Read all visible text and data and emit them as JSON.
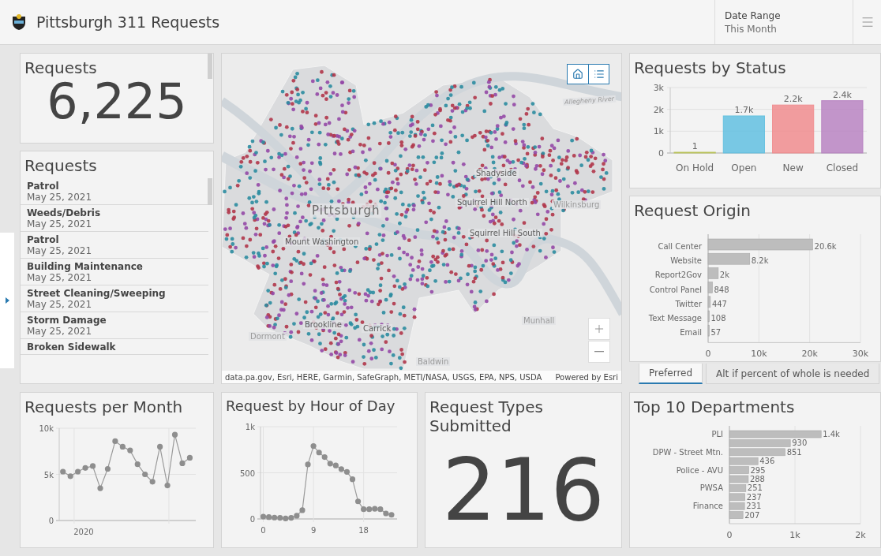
{
  "header": {
    "title": "Pittsburgh 311 Requests",
    "date_range": {
      "label": "Date Range",
      "value": "This Month"
    }
  },
  "request_count": {
    "title": "Requests",
    "value": "6,225"
  },
  "request_list": {
    "title": "Requests",
    "items": [
      {
        "type": "Patrol",
        "date": "May 25, 2021"
      },
      {
        "type": "Weeds/Debris",
        "date": "May 25, 2021"
      },
      {
        "type": "Patrol",
        "date": "May 25, 2021"
      },
      {
        "type": "Building Maintenance",
        "date": "May 25, 2021"
      },
      {
        "type": "Street Cleaning/Sweeping",
        "date": "May 25, 2021"
      },
      {
        "type": "Storm Damage",
        "date": "May 25, 2021"
      },
      {
        "type": "Broken Sidewalk"
      }
    ]
  },
  "map": {
    "place_labels": [
      {
        "text": "Pittsburgh",
        "kind": "city"
      },
      {
        "text": "Mount Washington",
        "kind": "neighborhood"
      },
      {
        "text": "Shadyside",
        "kind": "neighborhood"
      },
      {
        "text": "Squirrel Hill North",
        "kind": "neighborhood"
      },
      {
        "text": "Squirrel Hill South",
        "kind": "neighborhood"
      },
      {
        "text": "Wilkinsburg",
        "kind": "town"
      },
      {
        "text": "Brookline",
        "kind": "neighborhood"
      },
      {
        "text": "Carrick",
        "kind": "neighborhood"
      },
      {
        "text": "Dormont",
        "kind": "town"
      },
      {
        "text": "Munhall",
        "kind": "town"
      },
      {
        "text": "Baldwin",
        "kind": "town"
      },
      {
        "text": "Allegheny River",
        "kind": "river"
      }
    ],
    "attribution": "data.pa.gov, Esri, HERE, Garmin, SafeGraph, METI/NASA, USGS, EPA, NPS, USDA",
    "powered_by": "Powered by Esri"
  },
  "status_panel": {
    "title": "Requests by Status",
    "chart_data": {
      "type": "bar",
      "categories": [
        "On Hold",
        "Open",
        "New",
        "Closed"
      ],
      "series": [
        {
          "values": [
            1,
            1700,
            2200,
            2400
          ]
        }
      ],
      "colors": [
        "#b9c25a",
        "#62c0e0",
        "#f08c8e",
        "#b884c2"
      ],
      "ylim": [
        0,
        3000
      ],
      "yticks": [
        {
          "value": 0,
          "label": "0"
        },
        {
          "value": 1000,
          "label": "1k"
        },
        {
          "value": 2000,
          "label": "2k"
        },
        {
          "value": 3000,
          "label": "3k"
        }
      ],
      "value_labels": [
        "1",
        "1.7k",
        "2.2k",
        "2.4k"
      ]
    }
  },
  "origin_panel": {
    "title": "Request Origin",
    "chart_data": {
      "type": "bar",
      "orientation": "horizontal",
      "categories": [
        "Call Center",
        "Website",
        "Report2Gov",
        "Control Panel",
        "Twitter",
        "Text Message",
        "Email"
      ],
      "series": [
        {
          "color": "#bdbdbd",
          "values": [
            20600,
            8200,
            2000,
            848,
            447,
            108,
            57
          ]
        }
      ],
      "xlim": [
        0,
        30000
      ],
      "xticks": [
        {
          "value": 0,
          "label": "0"
        },
        {
          "value": 10000,
          "label": "10k"
        },
        {
          "value": 20000,
          "label": "20k"
        },
        {
          "value": 30000,
          "label": "30k"
        }
      ],
      "value_labels": [
        "20.6k",
        "8.2k",
        "2k",
        "848",
        "447",
        "108",
        "57"
      ]
    },
    "tabs": [
      {
        "label": "Preferred",
        "selected": true
      },
      {
        "label": "Alt if percent of whole is needed",
        "selected": false
      }
    ]
  },
  "monthly_panel": {
    "title": "Requests per Month",
    "chart_data": {
      "type": "line",
      "grid": true,
      "series": [
        {
          "color": "#9a9a9a",
          "marker": "circle",
          "values": [
            5300,
            4800,
            5300,
            5700,
            5900,
            3500,
            5600,
            8600,
            8000,
            7600,
            6100,
            5000,
            4200,
            8000,
            3800,
            9300,
            6200,
            6800
          ]
        }
      ],
      "ylim": [
        0,
        10000
      ],
      "yticks": [
        {
          "value": 0,
          "label": "0"
        },
        {
          "value": 5000,
          "label": "5k"
        },
        {
          "value": 10000,
          "label": "10k"
        }
      ],
      "annotations": [
        {
          "text": "2020"
        }
      ]
    }
  },
  "hourly_panel": {
    "title": "Request by Hour of Day",
    "chart_data": {
      "type": "line",
      "grid": true,
      "x": [
        0,
        1,
        2,
        3,
        4,
        5,
        6,
        7,
        8,
        9,
        10,
        11,
        12,
        13,
        14,
        15,
        16,
        17,
        18,
        19,
        20,
        21,
        22,
        23
      ],
      "series": [
        {
          "color": "#9a9a9a",
          "marker": "circle",
          "values": [
            25,
            20,
            15,
            12,
            5,
            12,
            35,
            95,
            590,
            790,
            720,
            670,
            600,
            580,
            540,
            510,
            430,
            190,
            105,
            105,
            110,
            105,
            60,
            45
          ]
        }
      ],
      "xlim": [
        -0.5,
        24
      ],
      "ylim": [
        0,
        1000
      ],
      "xticks": [
        0,
        9,
        18
      ],
      "yticks": [
        {
          "value": 0,
          "label": "0"
        },
        {
          "value": 500,
          "label": "500"
        },
        {
          "value": 1000,
          "label": "1k"
        }
      ]
    }
  },
  "types_panel": {
    "title": "Request Types Submitted",
    "value": "216"
  },
  "departments_panel": {
    "title": "Top 10 Departments",
    "chart_data": {
      "type": "bar",
      "orientation": "horizontal",
      "categories": [
        "PLI",
        null,
        "DPW - Street Mtn.",
        null,
        "Police - AVU",
        null,
        "PWSA",
        null,
        "Finance",
        null
      ],
      "series": [
        {
          "color": "#bdbdbd",
          "values": [
            1400,
            930,
            851,
            436,
            295,
            288,
            251,
            237,
            231,
            207
          ]
        }
      ],
      "xlim": [
        0,
        2000
      ],
      "xticks": [
        {
          "value": 0,
          "label": "0"
        },
        {
          "value": 1000,
          "label": "1k"
        },
        {
          "value": 2000,
          "label": "2k"
        }
      ],
      "value_labels": [
        "1.4k",
        "930",
        "851",
        "436",
        "295",
        "288",
        "251",
        "237",
        "231",
        "207"
      ]
    }
  }
}
